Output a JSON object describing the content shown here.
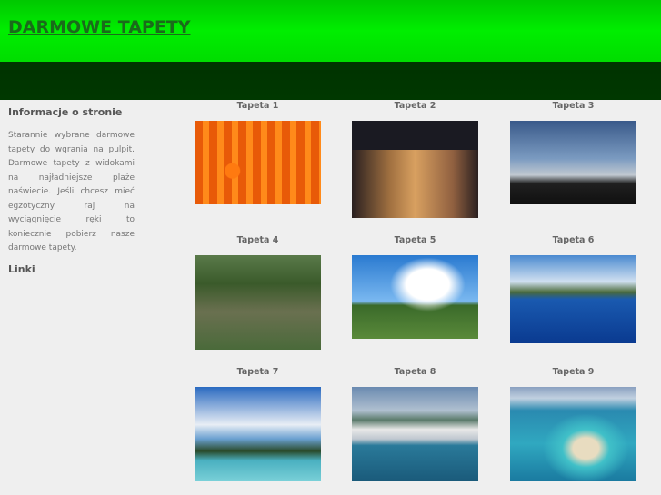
{
  "header": {
    "title": "DARMOWE TAPETY"
  },
  "sidebar": {
    "info_heading": "Informacje o stronie",
    "info_text": "Starannie wybrane darmowe tapety do wgrania na pulpit. Darmowe tapety z widokami na najładniejsze plaże naświecie. Jeśli chcesz mieć egzotyczny raj na wyciągnięcie ręki to koniecznie pobierz nasze darmowe tapety.",
    "links_heading": "Linki"
  },
  "gallery": [
    {
      "label": "Tapeta 1",
      "scene": "orange tulips field"
    },
    {
      "label": "Tapeta 2",
      "scene": "illuminated building at night"
    },
    {
      "label": "Tapeta 3",
      "scene": "palm trees at dusk"
    },
    {
      "label": "Tapeta 4",
      "scene": "dragon tree"
    },
    {
      "label": "Tapeta 5",
      "scene": "blue sky clouds trees"
    },
    {
      "label": "Tapeta 6",
      "scene": "resort pool with palms"
    },
    {
      "label": "Tapeta 7",
      "scene": "modern building by lagoon"
    },
    {
      "label": "Tapeta 8",
      "scene": "cruise ships in harbor"
    },
    {
      "label": "Tapeta 9",
      "scene": "aerial island beach"
    }
  ]
}
